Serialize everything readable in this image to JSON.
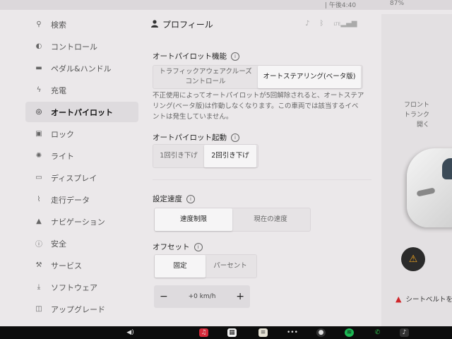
{
  "top_strip": {
    "left_text": "| 午後4:40",
    "right_text": "87%"
  },
  "sidebar": {
    "items": [
      {
        "label": "検索",
        "icon": "search-icon",
        "glyph": "⚲",
        "active": false
      },
      {
        "label": "コントロール",
        "icon": "toggle-icon",
        "glyph": "◐",
        "active": false
      },
      {
        "label": "ペダル&ハンドル",
        "icon": "car-icon",
        "glyph": "▬",
        "active": false
      },
      {
        "label": "充電",
        "icon": "lightning-icon",
        "glyph": "ϟ",
        "active": false
      },
      {
        "label": "オートパイロット",
        "icon": "steering-wheel-icon",
        "glyph": "◎",
        "active": true
      },
      {
        "label": "ロック",
        "icon": "lock-icon",
        "glyph": "▣",
        "active": false
      },
      {
        "label": "ライト",
        "icon": "light-bulb-icon",
        "glyph": "✺",
        "active": false
      },
      {
        "label": "ディスプレイ",
        "icon": "display-icon",
        "glyph": "▭",
        "active": false
      },
      {
        "label": "走行データ",
        "icon": "trip-icon",
        "glyph": "⌇",
        "active": false
      },
      {
        "label": "ナビゲーション",
        "icon": "navigation-icon",
        "glyph": "▲",
        "active": false
      },
      {
        "label": "安全",
        "icon": "safety-icon",
        "glyph": "ⓘ",
        "active": false
      },
      {
        "label": "サービス",
        "icon": "wrench-icon",
        "glyph": "⚒",
        "active": false
      },
      {
        "label": "ソフトウェア",
        "icon": "download-icon",
        "glyph": "⤓",
        "active": false
      },
      {
        "label": "アップグレード",
        "icon": "bag-icon",
        "glyph": "◫",
        "active": false
      }
    ]
  },
  "main": {
    "profile_label": "プロフィール",
    "profile_icon": "person-icon",
    "status_icons": [
      "bell-icon",
      "bluetooth-icon",
      "lte-signal-icon"
    ],
    "lte_label": "LTE",
    "autopilot_features": {
      "title": "オートパイロット機能",
      "options": [
        "トラフィックアウェアクルーズコントロール",
        "オートステアリング(ベータ版)"
      ],
      "selected_index": 1,
      "description": "不正使用によってオートパイロットが5回解除されると、オートステアリング(ベータ版)は作動しなくなります。この車両では該当するイベントは発生していません。"
    },
    "autopilot_activation": {
      "title": "オートパイロット起動",
      "options": [
        "1回引き下げ",
        "2回引き下げ"
      ],
      "selected_index": 1
    },
    "set_speed": {
      "title": "設定速度",
      "options": [
        "速度制限",
        "現在の速度"
      ],
      "selected_index": 0
    },
    "offset": {
      "title": "オフセット",
      "options": [
        "固定",
        "パーセント"
      ],
      "selected_index": 0,
      "stepper": {
        "minus": "−",
        "value": "+0 km/h",
        "plus": "+"
      }
    }
  },
  "right_panel": {
    "frunk_label_1": "フロント",
    "frunk_label_2": "トランク",
    "frunk_label_3": "開く",
    "seatbelt_warning": "シートベルトを着",
    "warning_icon": "warning-icon"
  },
  "taskbar": {
    "icons": [
      "volume-icon",
      "music-icon",
      "calendar-icon",
      "notes-icon",
      "more-icon",
      "camera-icon",
      "spotify-icon",
      "phone-icon",
      "controls-icon"
    ]
  },
  "colors": {
    "screen_bg": "#ebe8ea",
    "active_bg": "#dedbde",
    "warning_red": "#d0262a",
    "warning_amber": "#e8a020",
    "spotify_green": "#1db954",
    "phone_green": "#2fbf4b"
  }
}
